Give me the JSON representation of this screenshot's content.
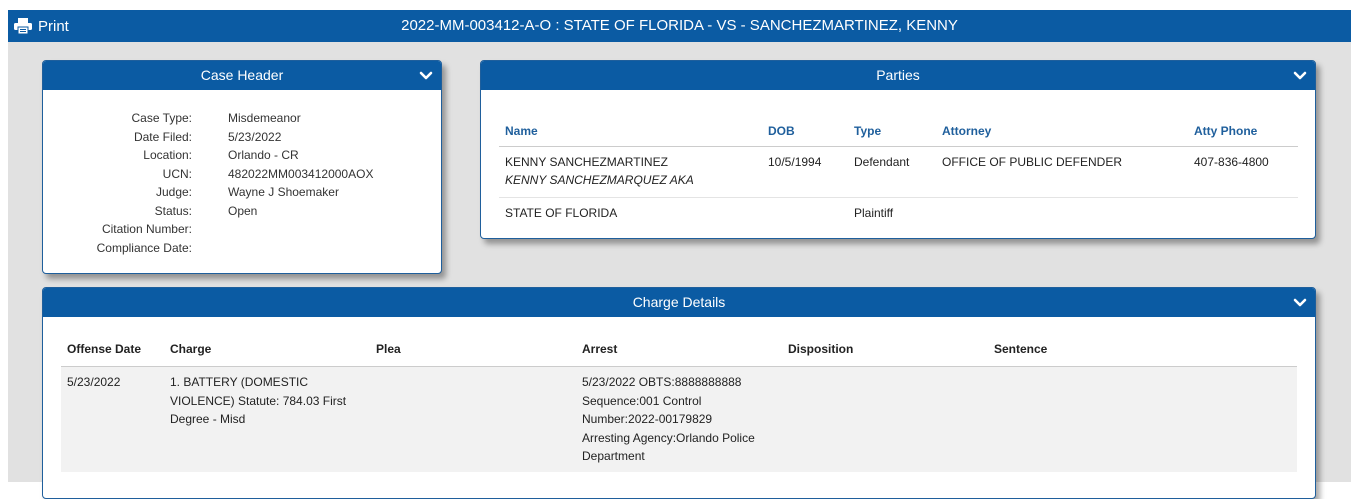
{
  "header": {
    "print_label": "Print",
    "case_title": "2022-MM-003412-A-O : STATE OF FLORIDA - VS - SANCHEZMARTINEZ, KENNY"
  },
  "case_header": {
    "title": "Case Header",
    "fields": [
      {
        "label": "Case Type:",
        "value": "Misdemeanor"
      },
      {
        "label": "Date Filed:",
        "value": "5/23/2022"
      },
      {
        "label": "Location:",
        "value": "Orlando - CR"
      },
      {
        "label": "UCN:",
        "value": "482022MM003412000AOX"
      },
      {
        "label": "Judge:",
        "value": "Wayne J Shoemaker"
      },
      {
        "label": "Status:",
        "value": "Open"
      },
      {
        "label": "Citation Number:",
        "value": ""
      },
      {
        "label": "Compliance Date:",
        "value": ""
      }
    ]
  },
  "parties": {
    "title": "Parties",
    "columns": [
      "Name",
      "DOB",
      "Type",
      "Attorney",
      "Atty Phone"
    ],
    "rows": [
      {
        "name": "KENNY SANCHEZMARTINEZ",
        "aka": "KENNY SANCHEZMARQUEZ AKA",
        "dob": "10/5/1994",
        "type": "Defendant",
        "attorney": "OFFICE OF PUBLIC DEFENDER",
        "phone": "407-836-4800"
      },
      {
        "name": "STATE OF FLORIDA",
        "aka": "",
        "dob": "",
        "type": "Plaintiff",
        "attorney": "",
        "phone": ""
      }
    ]
  },
  "charges": {
    "title": "Charge Details",
    "columns": [
      "Offense Date",
      "Charge",
      "Plea",
      "Arrest",
      "Disposition",
      "Sentence"
    ],
    "rows": [
      {
        "offense_date": "5/23/2022",
        "charge": "1. BATTERY (DOMESTIC\nVIOLENCE) Statute: 784.03 First\nDegree - Misd",
        "plea": "",
        "arrest": "5/23/2022 OBTS:8888888888\nSequence:001 Control\nNumber:2022-00179829\nArresting Agency:Orlando Police\nDepartment",
        "disposition": "",
        "sentence": ""
      }
    ]
  },
  "colors": {
    "header_blue": "#0b5ba3",
    "link_blue": "#1f5f9c",
    "background_gray": "#e1e1e1"
  },
  "icons": {
    "print": "printer-icon",
    "collapse": "chevron-down-icon"
  }
}
